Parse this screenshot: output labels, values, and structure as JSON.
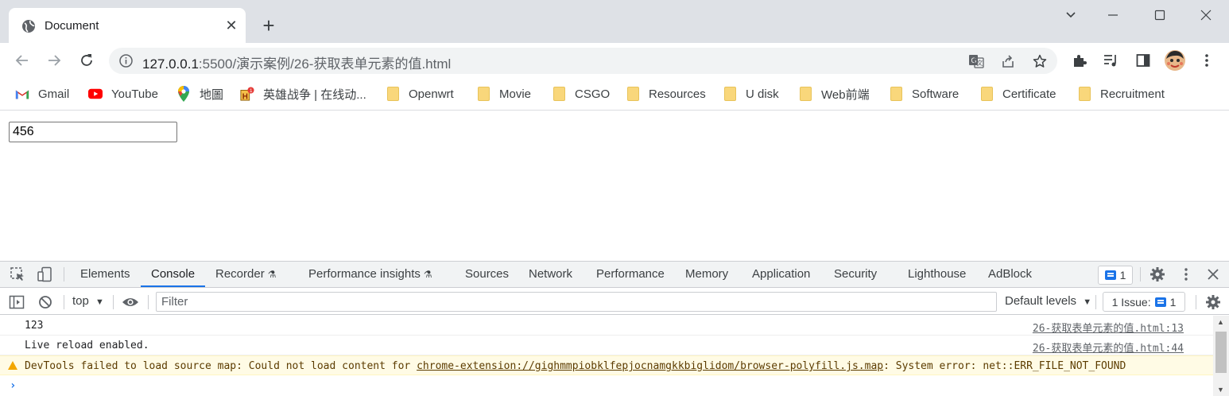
{
  "tab": {
    "title": "Document"
  },
  "omnibox": {
    "host": "127.0.0.1",
    "path": ":5500/演示案例/26-获取表单元素的值.html"
  },
  "bookmarks": [
    {
      "label": "Gmail",
      "icon": "gmail-icon"
    },
    {
      "label": "YouTube",
      "icon": "youtube-icon"
    },
    {
      "label": "地圖",
      "icon": "maps-icon"
    },
    {
      "label": "英雄战争 | 在线动...",
      "icon": "game-icon"
    },
    {
      "label": "Openwrt",
      "icon": "folder-icon"
    },
    {
      "label": "Movie",
      "icon": "folder-icon"
    },
    {
      "label": "CSGO",
      "icon": "folder-icon"
    },
    {
      "label": "Resources",
      "icon": "folder-icon"
    },
    {
      "label": "U disk",
      "icon": "folder-icon"
    },
    {
      "label": "Web前端",
      "icon": "folder-icon"
    },
    {
      "label": "Software",
      "icon": "folder-icon"
    },
    {
      "label": "Certificate",
      "icon": "folder-icon"
    },
    {
      "label": "Recruitment",
      "icon": "folder-icon"
    }
  ],
  "page": {
    "input_value": "456"
  },
  "devtools": {
    "tabs": [
      "Elements",
      "Console",
      "Recorder",
      "Performance insights",
      "Sources",
      "Network",
      "Performance",
      "Memory",
      "Application",
      "Security",
      "Lighthouse",
      "AdBlock"
    ],
    "issue_count": "1",
    "context": "top",
    "filter_placeholder": "Filter",
    "levels": "Default levels",
    "issues_label": "1 Issue:",
    "issues_count": "1",
    "console": [
      {
        "text": "123",
        "source": "26-获取表单元素的值.html:13"
      },
      {
        "text": "Live reload enabled.",
        "source": "26-获取表单元素的值.html:44"
      }
    ],
    "warning": {
      "prefix": "DevTools failed to load source map: Could not load content for ",
      "link": "chrome-extension://gighmmpiobklfepjocnamgkkbiglidom/browser-polyfill.js.map",
      "suffix": ": System error: net::ERR_FILE_NOT_FOUND"
    },
    "prompt": "›"
  }
}
